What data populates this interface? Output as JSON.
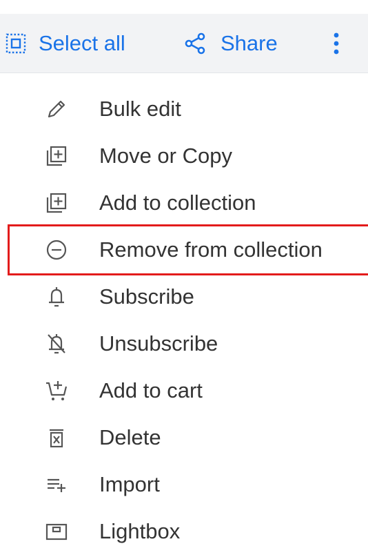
{
  "toolbar": {
    "select_all_label": "Select all",
    "select_all_icon": "select-all-icon",
    "share_label": "Share",
    "share_icon": "share-icon",
    "more_icon": "more-vertical-icon",
    "accent_color": "#1a73e8"
  },
  "menu": {
    "highlight_color": "#e31b1b",
    "items": [
      {
        "label": "Bulk edit",
        "icon": "pencil-icon"
      },
      {
        "label": "Move or Copy",
        "icon": "move-copy-icon"
      },
      {
        "label": "Add to collection",
        "icon": "add-collection-icon"
      },
      {
        "label": "Remove from collection",
        "icon": "remove-circle-icon",
        "highlighted": true
      },
      {
        "label": "Subscribe",
        "icon": "bell-icon"
      },
      {
        "label": "Unsubscribe",
        "icon": "bell-off-icon"
      },
      {
        "label": "Add to cart",
        "icon": "add-cart-icon"
      },
      {
        "label": "Delete",
        "icon": "trash-icon"
      },
      {
        "label": "Import",
        "icon": "import-list-icon"
      },
      {
        "label": "Lightbox",
        "icon": "lightbox-icon"
      }
    ]
  }
}
